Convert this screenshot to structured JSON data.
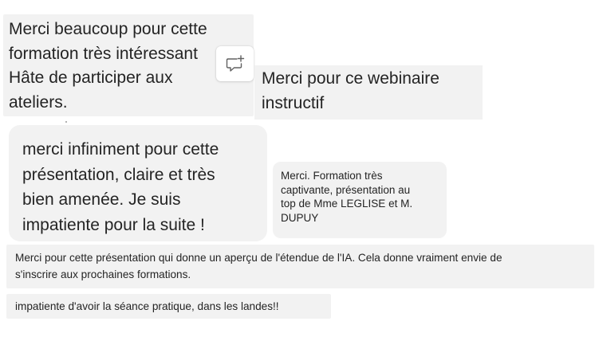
{
  "messages": [
    {
      "lines": [
        "Merci beaucoup pour cette",
        "formation très intéressant",
        "Hâte de participer aux",
        "ateliers."
      ]
    },
    {
      "lines": [
        "Merci pour ce webinaire",
        "instructif"
      ]
    },
    {
      "lines": [
        "merci infiniment pour cette",
        "présentation, claire et très",
        "bien amenée. Je suis",
        "impatiente pour la suite !"
      ]
    },
    {
      "lines": [
        "Merci. Formation très",
        "captivante, présentation au",
        "top de Mme LEGLISE et M.",
        "DUPUY"
      ]
    },
    {
      "lines": [
        "Merci pour cette présentation qui donne un aperçu de l'étendue de l'IA. Cela donne vraiment envie de",
        "s'inscrire aux prochaines formations."
      ]
    },
    {
      "lines": [
        "impatiente d'avoir la séance pratique, dans les landes!!"
      ]
    }
  ],
  "icons": {
    "reaction": "add-comment-icon"
  },
  "colors": {
    "bubble_background": "#f2f2f2",
    "text": "#242424",
    "icon": "#616161"
  }
}
